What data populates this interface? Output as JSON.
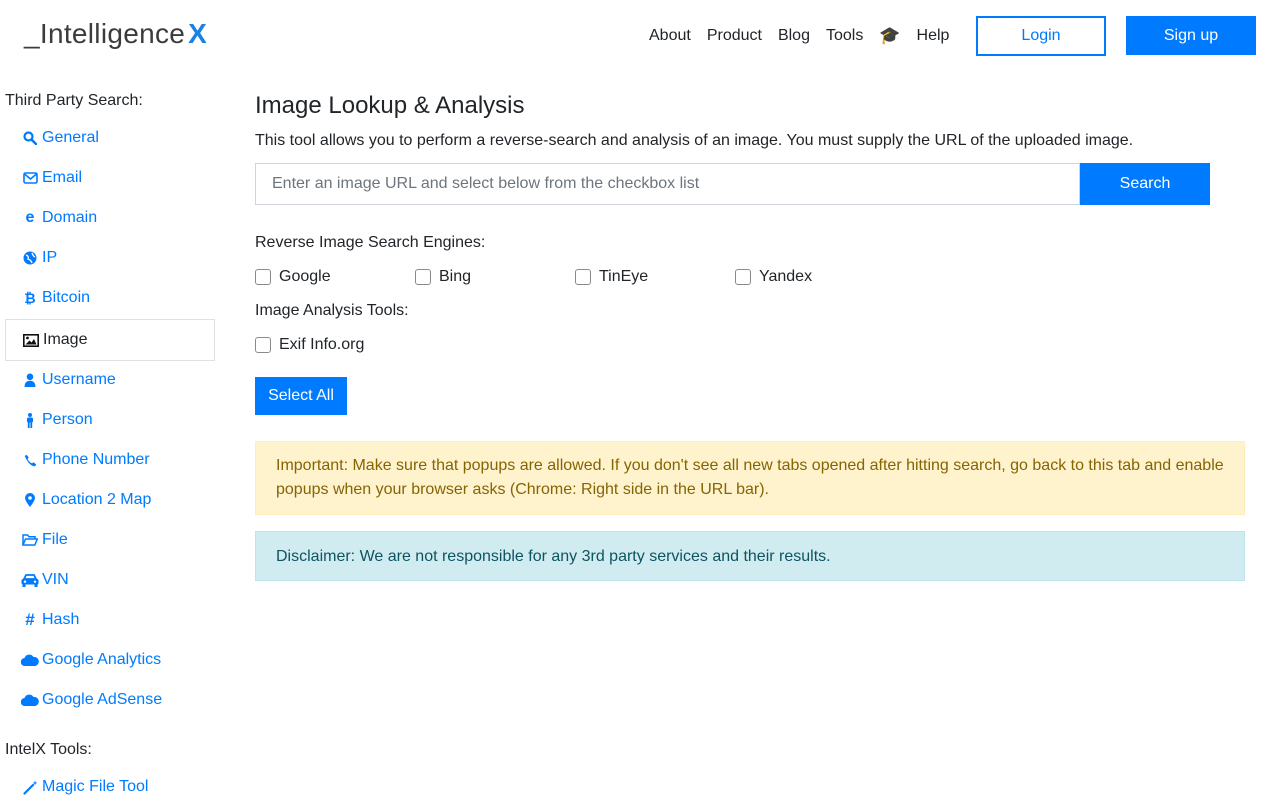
{
  "header": {
    "logo_prefix": "_Intelligence",
    "logo_suffix": "X",
    "nav": [
      "About",
      "Product",
      "Blog",
      "Tools"
    ],
    "academy_icon": "graduation-cap-icon",
    "help": "Help",
    "login": "Login",
    "signup": "Sign up"
  },
  "sidebar": {
    "third_party_title": "Third Party Search:",
    "items": [
      {
        "label": "General",
        "icon": "search-icon"
      },
      {
        "label": "Email",
        "icon": "envelope-icon"
      },
      {
        "label": "Domain",
        "icon": "internet-explorer-icon"
      },
      {
        "label": "IP",
        "icon": "globe-icon"
      },
      {
        "label": "Bitcoin",
        "icon": "bitcoin-icon"
      },
      {
        "label": "Image",
        "icon": "image-icon"
      },
      {
        "label": "Username",
        "icon": "user-icon"
      },
      {
        "label": "Person",
        "icon": "person-icon"
      },
      {
        "label": "Phone Number",
        "icon": "phone-icon"
      },
      {
        "label": "Location 2 Map",
        "icon": "map-marker-icon"
      },
      {
        "label": "File",
        "icon": "folder-open-icon"
      },
      {
        "label": "VIN",
        "icon": "car-icon"
      },
      {
        "label": "Hash",
        "icon": "hashtag-icon"
      },
      {
        "label": "Google Analytics",
        "icon": "cloud-icon"
      },
      {
        "label": "Google AdSense",
        "icon": "cloud-icon"
      }
    ],
    "intelx_title": "IntelX Tools:",
    "tools": [
      {
        "label": "Magic File Tool",
        "icon": "magic-wand-icon"
      }
    ]
  },
  "main": {
    "title": "Image Lookup & Analysis",
    "description": "This tool allows you to perform a reverse-search and analysis of an image. You must supply the URL of the uploaded image.",
    "search_placeholder": "Enter an image URL and select below from the checkbox list",
    "search_button": "Search",
    "engines_label": "Reverse Image Search Engines:",
    "engines": [
      "Google",
      "Bing",
      "TinEye",
      "Yandex"
    ],
    "analysis_label": "Image Analysis Tools:",
    "analysis_tools": [
      "Exif Info.org"
    ],
    "select_all": "Select All",
    "warning": "Important: Make sure that popups are allowed. If you don't see all new tabs opened after hitting search, go back to this tab and enable popups when your browser asks (Chrome: Right side in the URL bar).",
    "disclaimer": "Disclaimer: We are not responsible for any 3rd party services and their results."
  },
  "colors": {
    "primary": "#007bff",
    "logo_accent": "#1a82e2",
    "warning_bg": "#fff3cd",
    "info_bg": "#d1ecf1"
  }
}
